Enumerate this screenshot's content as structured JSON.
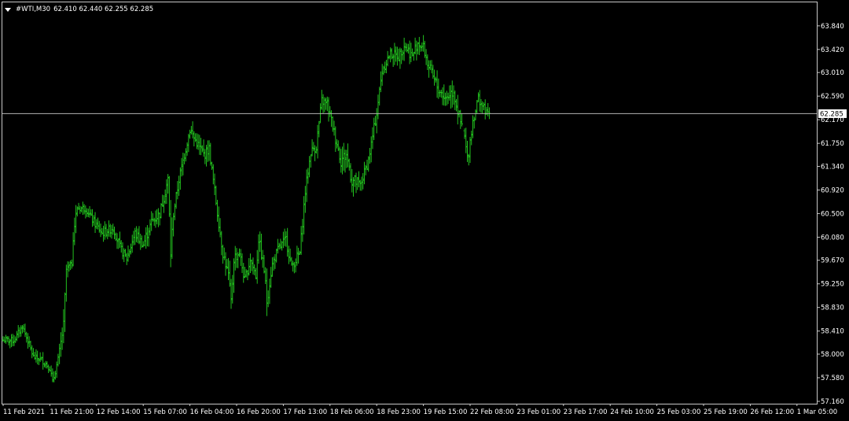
{
  "header": {
    "symbol": "#WTI,M30",
    "ohlc": "62.410 62.440 62.255 62.285"
  },
  "colors": {
    "background": "#000000",
    "bars": "#22c11e",
    "grid_frame": "#c8c8c8",
    "text": "#ffffff",
    "price_line": "#b4b4b4",
    "price_label_bg": "#ffffff",
    "price_label_text": "#000000"
  },
  "chart_data": {
    "type": "bar",
    "current_price": 62.285,
    "current_price_label": "62.285",
    "ylim": [
      57.16,
      64.02
    ],
    "y_ticks": [
      "63.840",
      "63.420",
      "63.010",
      "62.590",
      "62.170",
      "61.750",
      "61.340",
      "60.920",
      "60.500",
      "60.080",
      "59.670",
      "59.250",
      "58.830",
      "58.410",
      "58.000",
      "57.580",
      "57.160"
    ],
    "x_ticks": [
      "11 Feb 2021",
      "11 Feb 21:00",
      "12 Feb 14:00",
      "15 Feb 07:00",
      "16 Feb 04:00",
      "16 Feb 20:00",
      "17 Feb 13:00",
      "18 Feb 06:00",
      "18 Feb 23:00",
      "19 Feb 15:00",
      "22 Feb 08:00",
      "23 Feb 01:00",
      "23 Feb 17:00",
      "24 Feb 10:00",
      "25 Feb 03:00",
      "25 Feb 19:00",
      "26 Feb 12:00",
      "1 Mar 05:00"
    ],
    "bars_per_tick": 34,
    "close_path": [
      [
        0,
        58.25
      ],
      [
        8,
        58.25
      ],
      [
        14,
        58.5
      ],
      [
        20,
        58.1
      ],
      [
        22,
        57.95
      ],
      [
        28,
        57.9
      ],
      [
        34,
        57.75
      ],
      [
        36,
        57.5
      ],
      [
        40,
        57.9
      ],
      [
        44,
        58.5
      ],
      [
        46,
        59.5
      ],
      [
        50,
        59.6
      ],
      [
        51,
        60.15
      ],
      [
        54,
        60.6
      ],
      [
        60,
        60.6
      ],
      [
        66,
        60.35
      ],
      [
        72,
        60.15
      ],
      [
        80,
        60.25
      ],
      [
        86,
        59.85
      ],
      [
        90,
        59.7
      ],
      [
        96,
        60.15
      ],
      [
        102,
        59.95
      ],
      [
        108,
        60.35
      ],
      [
        114,
        60.5
      ],
      [
        120,
        61.1
      ],
      [
        122,
        59.8
      ],
      [
        124,
        60.5
      ],
      [
        128,
        61.1
      ],
      [
        136,
        62.0
      ],
      [
        140,
        61.8
      ],
      [
        146,
        61.55
      ],
      [
        150,
        61.65
      ],
      [
        154,
        60.9
      ],
      [
        158,
        60.15
      ],
      [
        160,
        59.8
      ],
      [
        164,
        59.4
      ],
      [
        166,
        58.9
      ],
      [
        168,
        59.7
      ],
      [
        172,
        59.8
      ],
      [
        176,
        59.3
      ],
      [
        180,
        59.7
      ],
      [
        184,
        59.4
      ],
      [
        186,
        60.05
      ],
      [
        190,
        59.5
      ],
      [
        192,
        58.95
      ],
      [
        196,
        59.6
      ],
      [
        200,
        59.85
      ],
      [
        206,
        60.05
      ],
      [
        210,
        59.55
      ],
      [
        216,
        59.8
      ],
      [
        220,
        60.9
      ],
      [
        224,
        61.6
      ],
      [
        228,
        61.7
      ],
      [
        232,
        62.5
      ],
      [
        236,
        62.45
      ],
      [
        242,
        61.85
      ],
      [
        246,
        61.45
      ],
      [
        250,
        61.55
      ],
      [
        254,
        61.1
      ],
      [
        260,
        61.0
      ],
      [
        266,
        61.45
      ],
      [
        272,
        62.3
      ],
      [
        276,
        63.05
      ],
      [
        282,
        63.35
      ],
      [
        288,
        63.3
      ],
      [
        292,
        63.5
      ],
      [
        298,
        63.3
      ],
      [
        302,
        63.55
      ],
      [
        306,
        63.45
      ],
      [
        310,
        63.1
      ],
      [
        316,
        62.75
      ],
      [
        322,
        62.55
      ],
      [
        328,
        62.7
      ],
      [
        332,
        62.2
      ],
      [
        336,
        61.85
      ],
      [
        338,
        61.45
      ],
      [
        342,
        62.15
      ],
      [
        346,
        62.55
      ],
      [
        352,
        62.28
      ],
      [
        354,
        62.285
      ]
    ],
    "range_profile": [
      [
        0,
        0.16
      ],
      [
        40,
        0.18
      ],
      [
        44,
        0.35
      ],
      [
        50,
        0.16
      ],
      [
        51,
        0.45
      ],
      [
        54,
        0.2
      ],
      [
        120,
        0.3
      ],
      [
        122,
        0.55
      ],
      [
        124,
        0.25
      ],
      [
        164,
        0.3
      ],
      [
        166,
        0.45
      ],
      [
        170,
        0.3
      ],
      [
        190,
        0.3
      ],
      [
        192,
        0.4
      ],
      [
        196,
        0.25
      ],
      [
        240,
        0.3
      ],
      [
        254,
        0.45
      ],
      [
        260,
        0.25
      ],
      [
        300,
        0.3
      ],
      [
        330,
        0.4
      ],
      [
        338,
        0.35
      ],
      [
        346,
        0.25
      ],
      [
        354,
        0.2
      ]
    ],
    "gaps": [
      [
        334,
        336
      ]
    ]
  }
}
